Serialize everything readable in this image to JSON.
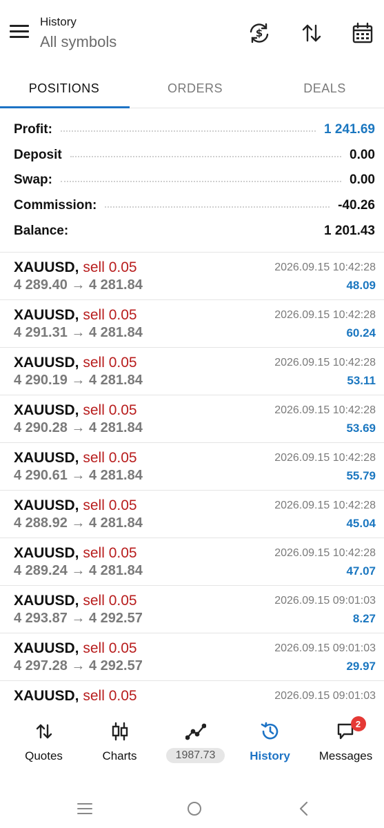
{
  "header": {
    "title": "History",
    "subtitle": "All symbols",
    "icons": [
      "currency-exchange-icon",
      "sort-icon",
      "calendar-icon"
    ]
  },
  "tabs": [
    {
      "label": "POSITIONS",
      "active": true
    },
    {
      "label": "ORDERS",
      "active": false
    },
    {
      "label": "DEALS",
      "active": false
    }
  ],
  "summary": [
    {
      "label": "Profit:",
      "value": "1 241.69"
    },
    {
      "label": "Deposit",
      "value": "0.00"
    },
    {
      "label": "Swap:",
      "value": "0.00"
    },
    {
      "label": "Commission:",
      "value": "-40.26"
    },
    {
      "label": "Balance:",
      "value": "1 201.43"
    }
  ],
  "deals": [
    {
      "symbol": "XAUUSD,",
      "side": "sell 0.05",
      "prices": "4 289.40 → 4 281.84",
      "time": "2026.09.15 10:42:28",
      "profit": "48.09"
    },
    {
      "symbol": "XAUUSD,",
      "side": "sell 0.05",
      "prices": "4 291.31 → 4 281.84",
      "time": "2026.09.15 10:42:28",
      "profit": "60.24"
    },
    {
      "symbol": "XAUUSD,",
      "side": "sell 0.05",
      "prices": "4 290.19 → 4 281.84",
      "time": "2026.09.15 10:42:28",
      "profit": "53.11"
    },
    {
      "symbol": "XAUUSD,",
      "side": "sell 0.05",
      "prices": "4 290.28 → 4 281.84",
      "time": "2026.09.15 10:42:28",
      "profit": "53.69"
    },
    {
      "symbol": "XAUUSD,",
      "side": "sell 0.05",
      "prices": "4 290.61 → 4 281.84",
      "time": "2026.09.15 10:42:28",
      "profit": "55.79"
    },
    {
      "symbol": "XAUUSD,",
      "side": "sell 0.05",
      "prices": "4 288.92 → 4 281.84",
      "time": "2026.09.15 10:42:28",
      "profit": "45.04"
    },
    {
      "symbol": "XAUUSD,",
      "side": "sell 0.05",
      "prices": "4 289.24 → 4 281.84",
      "time": "2026.09.15 10:42:28",
      "profit": "47.07"
    },
    {
      "symbol": "XAUUSD,",
      "side": "sell 0.05",
      "prices": "4 293.87 → 4 292.57",
      "time": "2026.09.15 09:01:03",
      "profit": "8.27"
    },
    {
      "symbol": "XAUUSD,",
      "side": "sell 0.05",
      "prices": "4 297.28 → 4 292.57",
      "time": "2026.09.15 09:01:03",
      "profit": "29.97"
    },
    {
      "symbol": "XAUUSD,",
      "side": "sell 0.05",
      "prices": "",
      "time": "2026.09.15 09:01:03",
      "profit": ""
    }
  ],
  "nav": {
    "quotes": "Quotes",
    "charts": "Charts",
    "trade_value": "1987.73",
    "history": "History",
    "messages": "Messages",
    "messages_badge": "2"
  },
  "colors": {
    "accent": "#1d73c5",
    "profit": "#1b77c0",
    "sell": "#b81d1d",
    "badge": "#e53935"
  }
}
